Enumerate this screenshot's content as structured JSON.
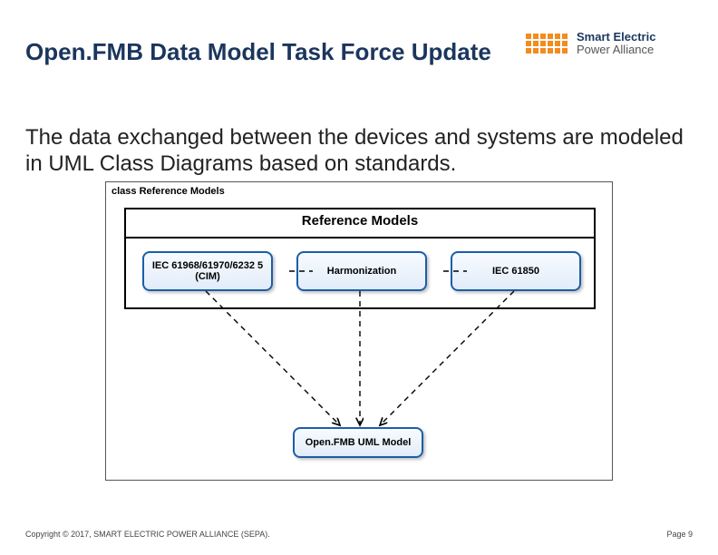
{
  "title": "Open.FMB Data Model Task Force Update",
  "logo": {
    "line1": "Smart Electric",
    "line2": "Power Alliance"
  },
  "subtitle": "The data exchanged between the devices and systems are modeled in UML Class Diagrams based on standards.",
  "diagram": {
    "frame_label": "class Reference Models",
    "ref_title": "Reference Models",
    "boxes": {
      "cim": "IEC 61968/61970/6232 5 (CIM)",
      "harm": "Harmonization",
      "iec850": "IEC 61850"
    },
    "out": "Open.FMB UML Model"
  },
  "footer": {
    "copyright": "Copyright © 2017, SMART ELECTRIC POWER ALLIANCE (SEPA).",
    "page": "Page 9"
  }
}
